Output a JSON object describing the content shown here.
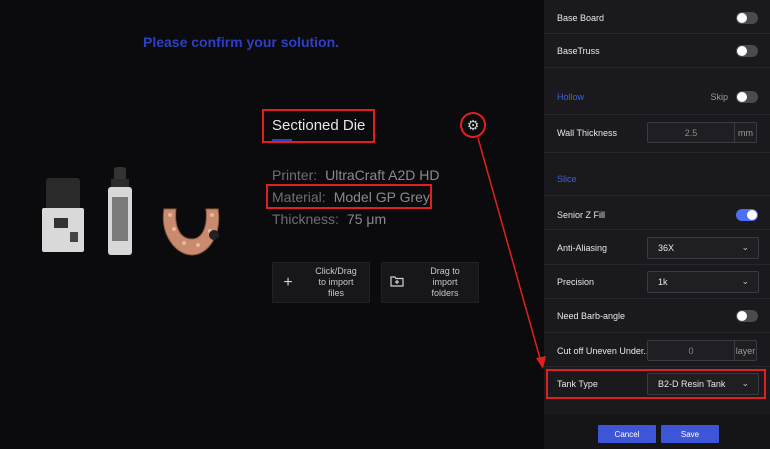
{
  "main": {
    "confirm_title": "Please confirm your solution.",
    "section_title": "Sectioned Die",
    "printer_label": "Printer:",
    "printer_value": "UltraCraft A2D HD",
    "material_label": "Material:",
    "material_value": "Model GP Grey",
    "thickness_label": "Thickness:",
    "thickness_value": "75 μm",
    "import_files": "Click/Drag\nto import\nfiles",
    "import_folders": "Drag to\nimport\nfolders",
    "icons": [
      "printer-image",
      "resin-bottle-image",
      "die-model-image",
      "gear-icon",
      "plus-icon",
      "folder-import-icon"
    ]
  },
  "panel": {
    "base_board": "Base Board",
    "base_truss": "BaseTruss",
    "hollow_header": "Hollow",
    "skip_label": "Skip",
    "wall_thickness_label": "Wall Thickness",
    "wall_thickness_value": "2.5",
    "wall_thickness_unit": "mm",
    "slice_header": "Slice",
    "senior_z_fill": "Senior Z Fill",
    "anti_aliasing_label": "Anti-Aliasing",
    "anti_aliasing_value": "36X",
    "precision_label": "Precision",
    "precision_value": "1k",
    "barb_angle_label": "Need Barb-angle",
    "cut_off_label": "Cut off Uneven Under...",
    "cut_off_value": "0",
    "cut_off_unit": "layer",
    "tank_type_label": "Tank Type",
    "tank_type_value": "B2-D Resin Tank",
    "toggles": {
      "base_board": false,
      "base_truss": false,
      "hollow_skip": false,
      "senior_z_fill": true,
      "barb_angle": false
    }
  },
  "footer": {
    "cancel_label": "Cancel",
    "save_label": "Save"
  },
  "colors": {
    "accent": "#3d55d6",
    "annotation": "#e02020",
    "title_blue": "#2e3fc7"
  }
}
